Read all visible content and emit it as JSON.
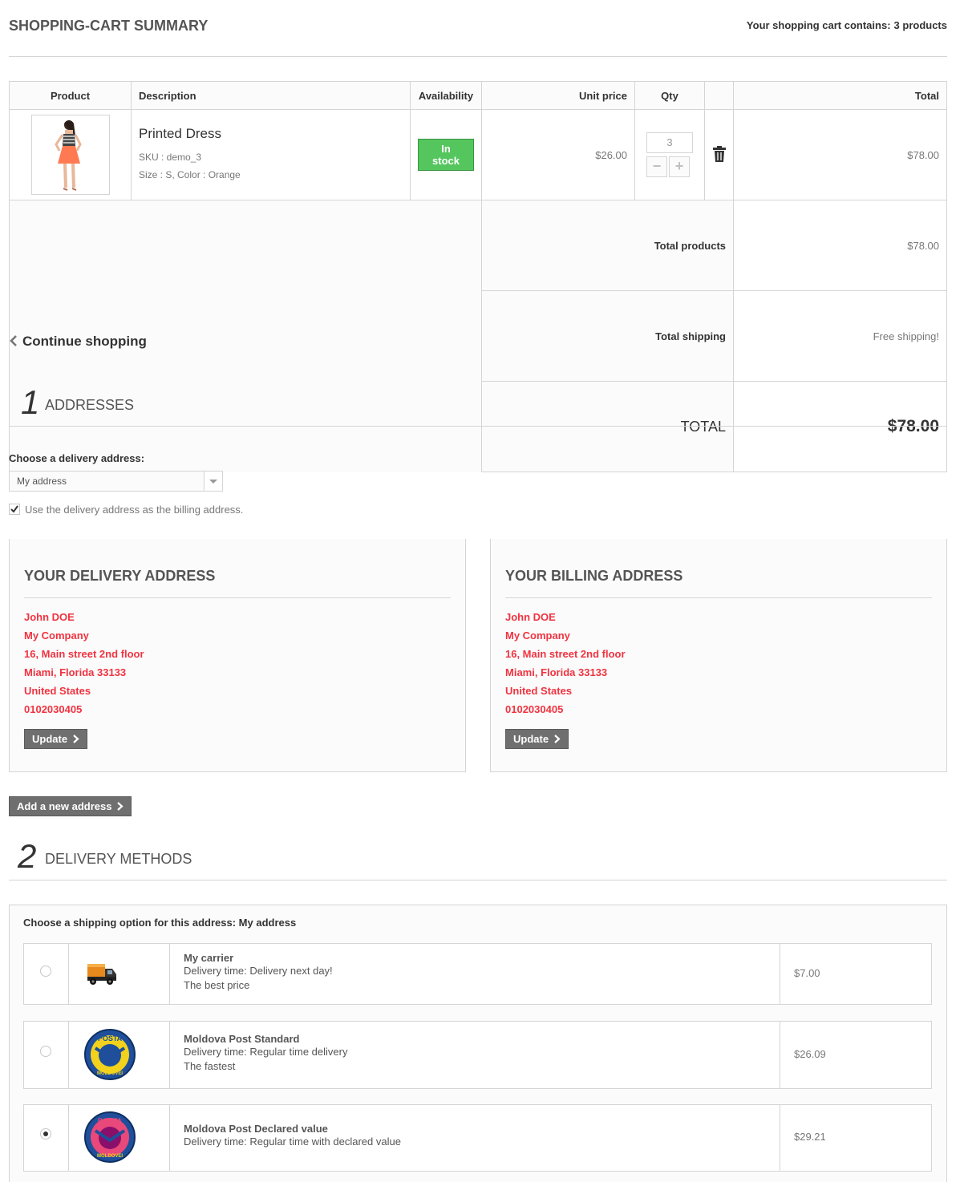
{
  "header": {
    "title": "Shopping-cart summary",
    "count_prefix": "Your shopping cart contains:",
    "count_value": "3 products"
  },
  "cart": {
    "columns": [
      "Product",
      "Description",
      "Availability",
      "Unit price",
      "Qty",
      "",
      "Total"
    ],
    "item": {
      "name": "Printed Dress",
      "sku": "SKU : demo_3",
      "attributes": "Size : S, Color : Orange",
      "availability": "In stock",
      "unit_price": "$26.00",
      "qty": "3",
      "total": "$78.00",
      "minus_glyph": "−",
      "plus_glyph": "+"
    },
    "totals": {
      "products_label": "Total products",
      "products_value": "$78.00",
      "shipping_label": "Total shipping",
      "shipping_value": "Free shipping!",
      "total_label": "TOTAL",
      "total_value": "$78.00"
    }
  },
  "continue_shopping": "Continue shopping",
  "addresses": {
    "step": "1",
    "title": "Addresses",
    "choose_label": "Choose a delivery address:",
    "selected": "My address",
    "same_billing_label": "Use the delivery address as the billing address.",
    "same_billing_checked": true,
    "delivery": {
      "title": "Your delivery address",
      "lines": [
        "John DOE",
        "My Company",
        "16, Main street 2nd floor",
        "Miami, Florida 33133",
        "United States",
        "0102030405"
      ],
      "update_label": "Update"
    },
    "billing": {
      "title": "Your billing address",
      "lines": [
        "John DOE",
        "My Company",
        "16, Main street 2nd floor",
        "Miami, Florida 33133",
        "United States",
        "0102030405"
      ],
      "update_label": "Update"
    },
    "add_new_label": "Add a new address",
    "address_color": "#f13340"
  },
  "delivery": {
    "step": "2",
    "title": "Delivery methods",
    "choose_label": "Choose a shipping option for this address: My address",
    "carriers": [
      {
        "name": "My carrier",
        "line1": "Delivery time: Delivery next day!",
        "line2": "The best price",
        "price": "$7.00",
        "selected": false,
        "icon": "truck-icon"
      },
      {
        "name": "Moldova Post Standard",
        "line1": "Delivery time: Regular time delivery",
        "line2": "The fastest",
        "price": "$26.09",
        "selected": false,
        "icon": "posta-moldovei-logo"
      },
      {
        "name": "Moldova Post Declared value",
        "line1": "Delivery time: Regular time with declared value",
        "line2": "",
        "price": "$29.21",
        "selected": true,
        "icon": "posta-moldovei-logo"
      }
    ],
    "logo_text_top": "POSTA",
    "logo_text_bottom": "MOLDOVEI"
  },
  "colors": {
    "in_stock": "#55c65e",
    "button_grey": "#6f6f6f",
    "border": "#d6d4d4"
  }
}
